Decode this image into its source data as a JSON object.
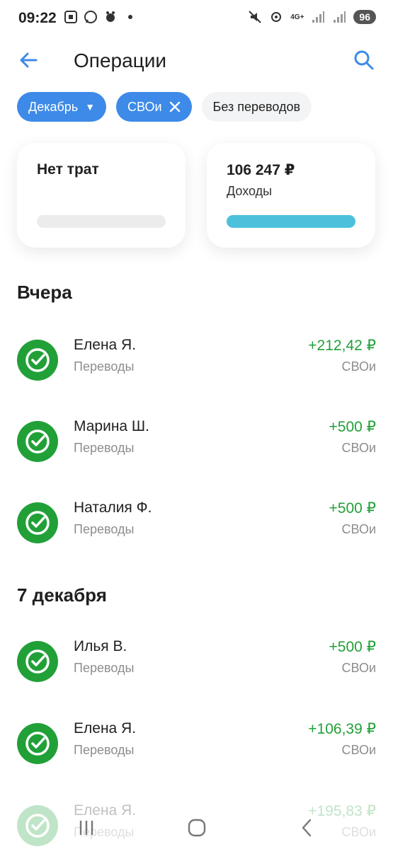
{
  "status_bar": {
    "time": "09:22",
    "battery": "96",
    "network": "4G+"
  },
  "header": {
    "title": "Операции",
    "back_icon": "arrow-left-icon",
    "search_icon": "search-icon"
  },
  "filters": [
    {
      "label": "Декабрь",
      "style": "blue",
      "suffix": "caret"
    },
    {
      "label": "СВОи",
      "style": "blue",
      "suffix": "close"
    },
    {
      "label": "Без переводов",
      "style": "gray",
      "suffix": ""
    }
  ],
  "summary": {
    "expenses": {
      "title": "Нет трат",
      "progress": 0
    },
    "income": {
      "amount": "106 247 ₽",
      "label": "Доходы",
      "progress": 1.0
    }
  },
  "sections": [
    {
      "title": "Вчера",
      "operations": [
        {
          "name": "Елена Я.",
          "category": "Переводы",
          "amount": "+212,42 ₽",
          "account": "СВОи"
        },
        {
          "name": "Марина Ш.",
          "category": "Переводы",
          "amount": "+500 ₽",
          "account": "СВОи"
        },
        {
          "name": "Наталия Ф.",
          "category": "Переводы",
          "amount": "+500 ₽",
          "account": "СВОи"
        }
      ]
    },
    {
      "title": "7 декабря",
      "operations": [
        {
          "name": "Илья В.",
          "category": "Переводы",
          "amount": "+500 ₽",
          "account": "СВОи"
        },
        {
          "name": "Елена Я.",
          "category": "Переводы",
          "amount": "+106,39 ₽",
          "account": "СВОи"
        },
        {
          "name": "Елена Я.",
          "category": "Переводы",
          "amount": "+195,83 ₽",
          "account": "СВОи"
        }
      ]
    }
  ],
  "colors": {
    "accent": "#3d8ae8",
    "income_green": "#21a038",
    "income_bar": "#4dc1dc"
  }
}
